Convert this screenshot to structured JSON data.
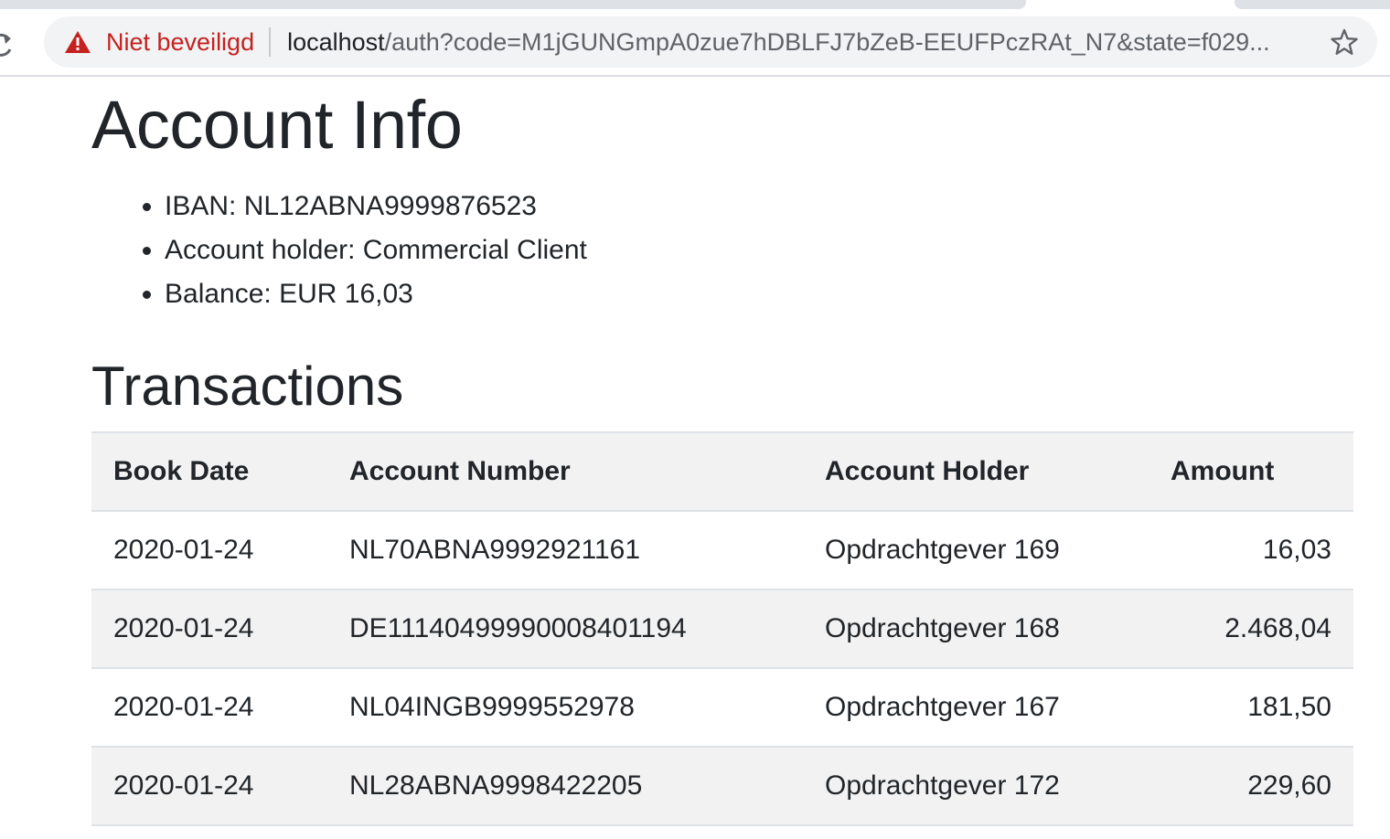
{
  "browser": {
    "security_label": "Niet beveiligd",
    "url_host": "localhost",
    "url_path": "/auth?code=M1jGUNGmpA0zue7hDBLFJ7bZeB-EEUFPczRAt_N7&state=f029..."
  },
  "page": {
    "title": "Account Info",
    "info_items": [
      "IBAN: NL12ABNA9999876523",
      "Account holder: Commercial Client",
      "Balance: EUR 16,03"
    ],
    "transactions_heading": "Transactions"
  },
  "table": {
    "headers": [
      "Book Date",
      "Account Number",
      "Account Holder",
      "Amount"
    ],
    "rows": [
      [
        "2020-01-24",
        "NL70ABNA9992921161",
        "Opdrachtgever 169",
        "16,03"
      ],
      [
        "2020-01-24",
        "DE11140499990008401194",
        "Opdrachtgever 168",
        "2.468,04"
      ],
      [
        "2020-01-24",
        "NL04INGB9999552978",
        "Opdrachtgever 167",
        "181,50"
      ],
      [
        "2020-01-24",
        "NL28ABNA9998422205",
        "Opdrachtgever 172",
        "229,60"
      ]
    ]
  },
  "colors": {
    "security_warning": "#c5221f",
    "row_stripe": "#f2f2f2",
    "text": "#212529"
  },
  "icons": {
    "reload": "reload-icon",
    "warning": "warning-triangle-icon",
    "bookmark": "star-icon"
  }
}
